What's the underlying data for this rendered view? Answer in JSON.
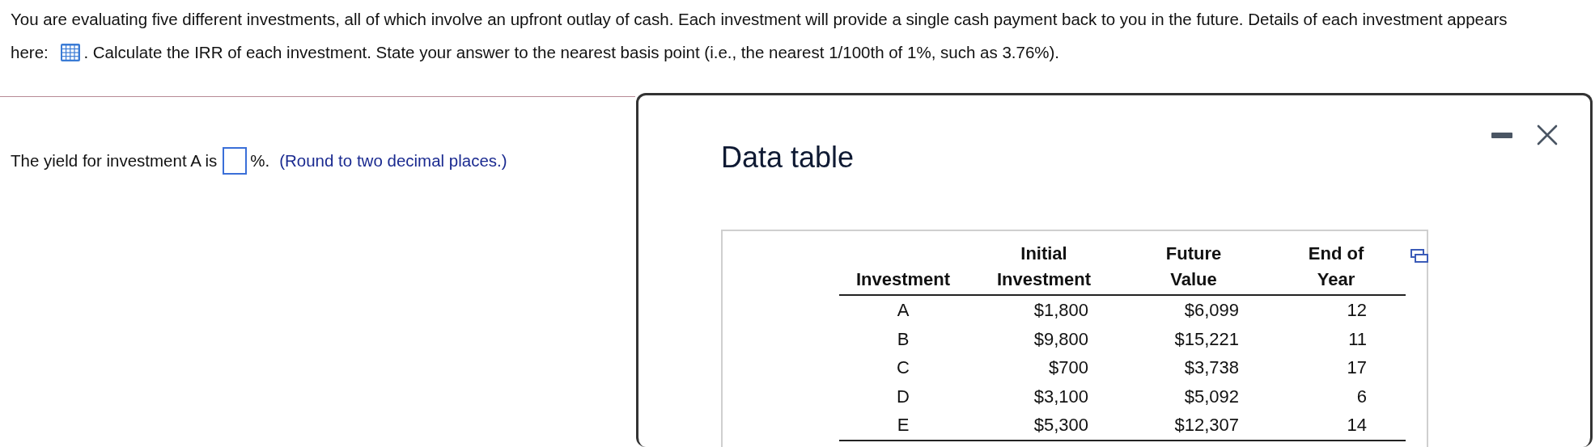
{
  "question": {
    "text_before_icon": "You are evaluating five different investments, all of which involve an upfront outlay of cash. Each investment will provide a single cash payment back to you in the future. Details of each investment appears here:",
    "text_after_icon": ". Calculate the IRR of each investment. State your answer to the nearest basis point (i.e., the nearest 1/100th of 1%, such as 3.76%)."
  },
  "answer": {
    "prompt": "The yield for investment A is",
    "unit": "%.",
    "hint": "(Round to two decimal places.)"
  },
  "dialog": {
    "title": "Data table",
    "table": {
      "header_top": [
        "Initial",
        "Future",
        "End of"
      ],
      "columns": [
        "Investment",
        "Investment",
        "Value",
        "Year"
      ],
      "rows": [
        [
          "A",
          "$1,800",
          "$6,099",
          "12"
        ],
        [
          "B",
          "$9,800",
          "$15,221",
          "11"
        ],
        [
          "C",
          "$700",
          "$3,738",
          "17"
        ],
        [
          "D",
          "$3,100",
          "$5,092",
          "6"
        ],
        [
          "E",
          "$5,300",
          "$12,307",
          "14"
        ]
      ]
    }
  }
}
